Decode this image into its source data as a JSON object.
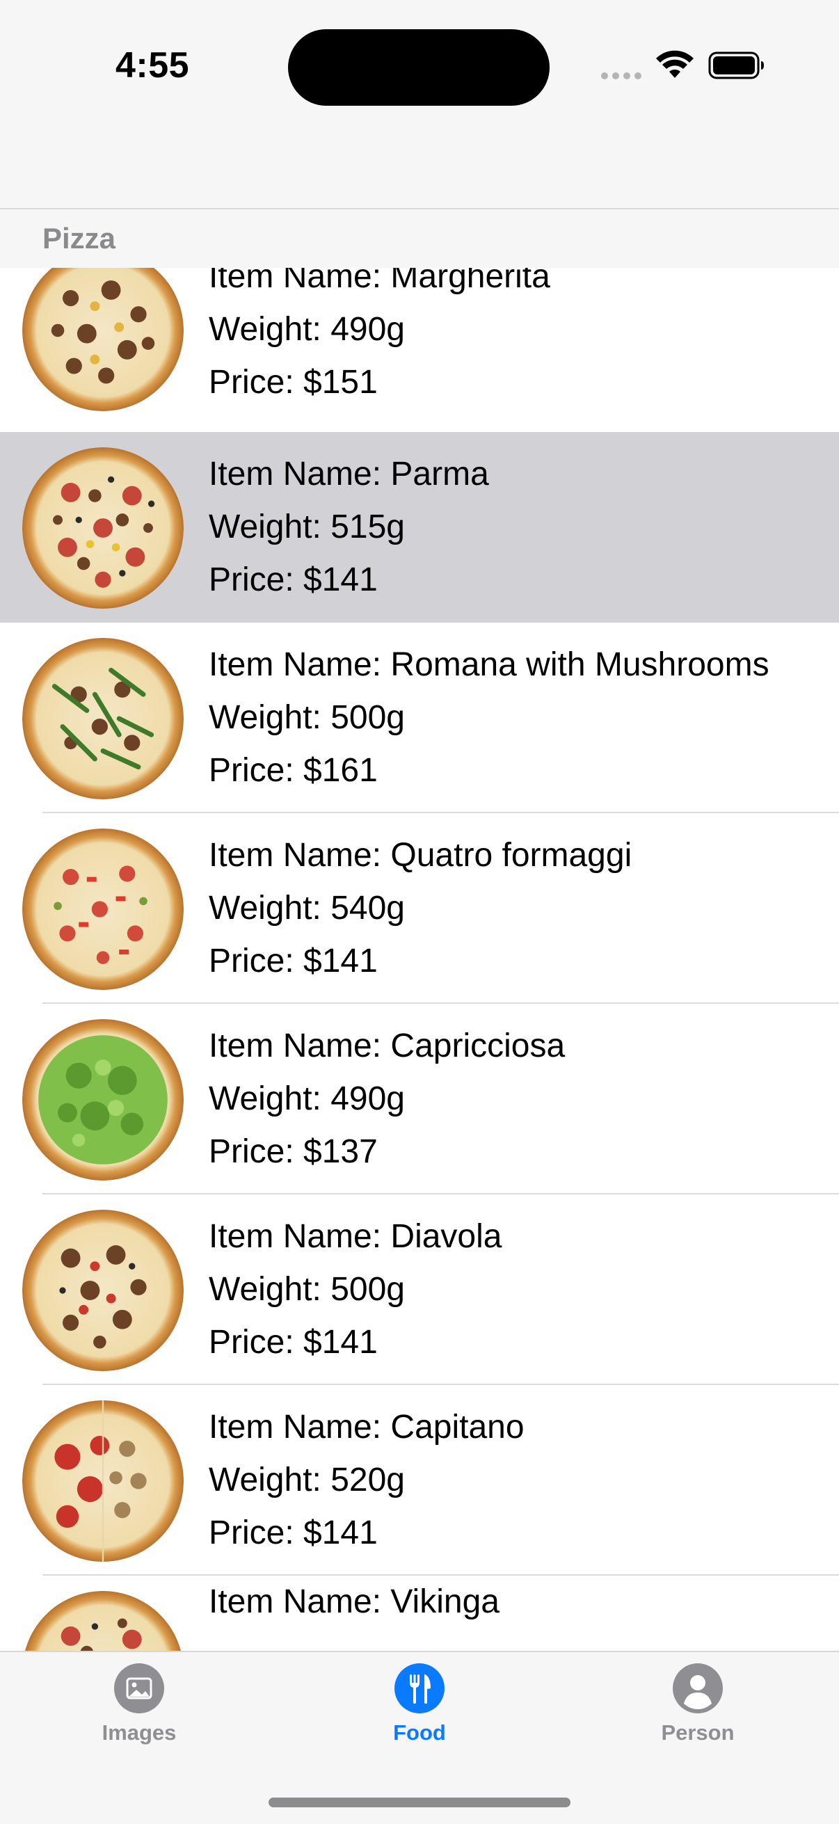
{
  "status_bar": {
    "time": "4:55"
  },
  "section": {
    "title": "Pizza"
  },
  "items": [
    {
      "name": "Item Name: Margherita",
      "weight": "Weight: 490g",
      "price": "Price: $151",
      "topping": "meat"
    },
    {
      "name": "Item Name: Parma",
      "weight": "Weight: 515g",
      "price": "Price: $141",
      "topping": "mixed",
      "selected": true
    },
    {
      "name": "Item Name: Romana with Mushrooms",
      "weight": "Weight: 500g",
      "price": "Price: $161",
      "topping": "arugula"
    },
    {
      "name": "Item Name: Quatro formaggi",
      "weight": "Weight: 540g",
      "price": "Price: $141",
      "topping": "peppers"
    },
    {
      "name": "Item Name: Capricciosa",
      "weight": "Weight: 490g",
      "price": "Price: $137",
      "topping": "greens"
    },
    {
      "name": "Item Name: Diavola",
      "weight": "Weight: 500g",
      "price": "Price: $141",
      "topping": "meat"
    },
    {
      "name": "Item Name: Capitano",
      "weight": "Weight: 520g",
      "price": "Price: $141",
      "topping": "pepperoni"
    },
    {
      "name": "Item Name: Vikinga",
      "weight": "",
      "price": "",
      "topping": "mixed"
    }
  ],
  "tab_bar": {
    "tabs": [
      {
        "label": "Images",
        "icon": "photo-icon",
        "active": false
      },
      {
        "label": "Food",
        "icon": "fork-knife-icon",
        "active": true
      },
      {
        "label": "Person",
        "icon": "person-icon",
        "active": false
      }
    ]
  },
  "colors": {
    "accent": "#0a7aff",
    "inactive_tab": "#8e8e93",
    "selected_row": "#d1d1d6",
    "background": "#f6f6f7"
  }
}
